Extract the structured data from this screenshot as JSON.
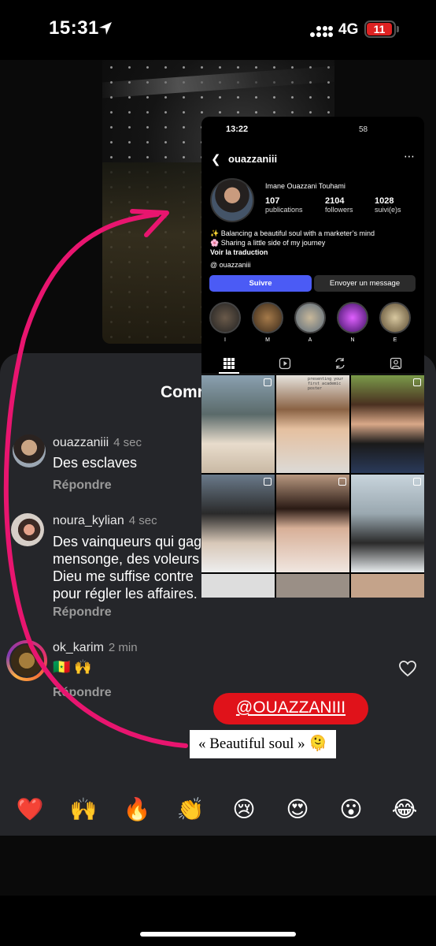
{
  "status_bar": {
    "time": "15:31",
    "network": "4G",
    "battery": "11"
  },
  "comments_sheet": {
    "title": "Comm",
    "comments": [
      {
        "user": "ouazzaniii",
        "time": "4 sec",
        "lines": [
          "Des esclaves"
        ],
        "reply": "Répondre"
      },
      {
        "user": "noura_kylian",
        "time": "4 sec",
        "lines": [
          "Des vainqueurs qui gag",
          "mensonge, des voleurs",
          "Dieu me suffise contre",
          "pour régler les affaires."
        ],
        "reply": "Répondre"
      },
      {
        "user": "ok_karim",
        "time": "2 min",
        "lines": [
          "🇸🇳 🙌"
        ],
        "reply": "Répondre"
      }
    ]
  },
  "reactions": [
    "❤️",
    "🙌",
    "🔥",
    "👏",
    "😢",
    "😍",
    "😮",
    "😂"
  ],
  "profile_shot": {
    "time": "13:22",
    "battery": "58",
    "username": "ouazzaniii",
    "display_name": "Imane Ouazzani Touhami",
    "stats": [
      {
        "num": "107",
        "label": "publications"
      },
      {
        "num": "2104",
        "label": "followers"
      },
      {
        "num": "1028",
        "label": "suivi(e)s"
      }
    ],
    "bio": [
      "✨ Balancing a beautiful soul with a marketer’s mind",
      "🌸 Sharing a little side of my journey"
    ],
    "translate": "Voir la traduction",
    "threads": "ouazzaniii",
    "follow_label": "Suivre",
    "message_label": "Envoyer un message",
    "highlights": [
      "I",
      "M",
      "A",
      "N",
      "E"
    ],
    "grid_caption": "presenting your first academic poster"
  },
  "mention_sticker": "@OUAZZANIII",
  "quote_sticker": "« Beautiful soul » 🫠",
  "colors": {
    "sheet": "#25262a",
    "follow": "#4b5bf5",
    "mention": "#e0121a",
    "arrow": "#e8156f"
  }
}
